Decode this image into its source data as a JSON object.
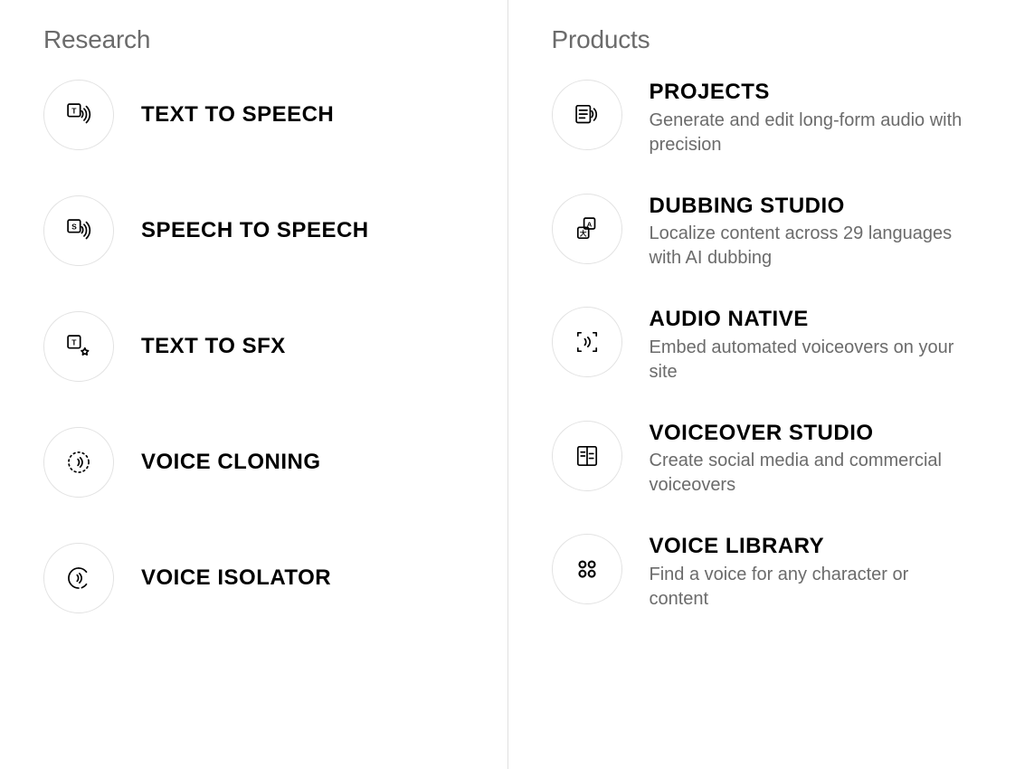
{
  "left": {
    "heading": "Research",
    "items": [
      {
        "title": "TEXT TO SPEECH",
        "desc": null
      },
      {
        "title": "SPEECH TO SPEECH",
        "desc": null
      },
      {
        "title": "TEXT TO SFX",
        "desc": null
      },
      {
        "title": "VOICE CLONING",
        "desc": null
      },
      {
        "title": "VOICE ISOLATOR",
        "desc": null
      }
    ]
  },
  "right": {
    "heading": "Products",
    "items": [
      {
        "title": "PROJECTS",
        "desc": "Generate and edit long-form audio with precision"
      },
      {
        "title": "DUBBING STUDIO",
        "desc": "Localize content across 29 languages with AI dubbing"
      },
      {
        "title": "AUDIO NATIVE",
        "desc": "Embed automated voiceovers on your site"
      },
      {
        "title": "VOICEOVER STUDIO",
        "desc": "Create social media and commercial voiceovers"
      },
      {
        "title": "VOICE LIBRARY",
        "desc": "Find a voice for any character or content"
      }
    ]
  }
}
